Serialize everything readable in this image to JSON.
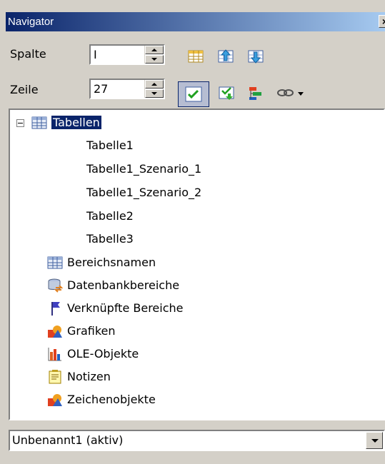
{
  "window": {
    "title": "Navigator",
    "close_glyph": "×"
  },
  "controls": {
    "column_label": "Spalte",
    "column_value": "I",
    "row_label": "Zeile",
    "row_value": "27"
  },
  "toolbar": {
    "icons": [
      "data-range-icon",
      "start-icon",
      "end-icon",
      "contents-icon",
      "toggle-icon",
      "scenarios-icon",
      "drag-mode-icon",
      "dropdown-arrow-icon"
    ]
  },
  "tree": {
    "root_label": "Tabellen",
    "sheets": [
      "Tabelle1",
      "Tabelle1_Szenario_1",
      "Tabelle1_Szenario_2",
      "Tabelle2",
      "Tabelle3"
    ],
    "categories": [
      {
        "label": "Bereichsnamen",
        "icon": "range-names-icon"
      },
      {
        "label": "Datenbankbereiche",
        "icon": "database-ranges-icon"
      },
      {
        "label": "Verknüpfte Bereiche",
        "icon": "linked-areas-flag-icon"
      },
      {
        "label": "Grafiken",
        "icon": "graphics-icon"
      },
      {
        "label": "OLE-Objekte",
        "icon": "ole-objects-icon"
      },
      {
        "label": "Notizen",
        "icon": "notes-icon"
      },
      {
        "label": "Zeichenobjekte",
        "icon": "drawing-objects-icon"
      }
    ]
  },
  "document_select": {
    "value": "Unbenannt1 (aktiv)"
  }
}
